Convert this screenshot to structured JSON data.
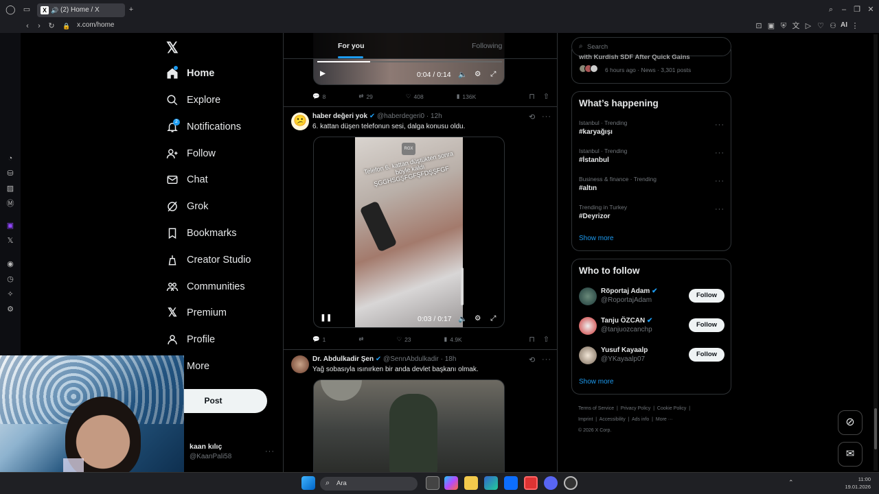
{
  "browser": {
    "tab_title": "(2) Home / X",
    "url": "x.com/home",
    "ai_label": "AI"
  },
  "nav": {
    "home": "Home",
    "explore": "Explore",
    "notifications": "Notifications",
    "notifications_badge": "2",
    "follow": "Follow",
    "chat": "Chat",
    "grok": "Grok",
    "bookmarks": "Bookmarks",
    "creator_studio": "Creator Studio",
    "communities": "Communities",
    "premium": "Premium",
    "profile": "Profile",
    "more": "More",
    "post": "Post",
    "user_name": "kaan kılıç",
    "user_handle": "@KaanPali58"
  },
  "feed": {
    "tab_for_you": "For you",
    "tab_following": "Following",
    "post0": {
      "time": "0:04 / 0:14",
      "replies": "8",
      "reposts": "29",
      "likes": "408",
      "views": "136K"
    },
    "post1": {
      "author": "haber değeri yok",
      "handle": "@haberdegeri0",
      "time": "12h",
      "text": "6. kattan düşen telefonun sesi, dalga konusu oldu.",
      "overlay_text": "Telefon 6. kattan düştükten sonra böyle kaldı ŞGGHSGŞFGFŞFDŞŞFGF",
      "video_time": "0:03 / 0:17",
      "replies": "1",
      "likes": "23",
      "views": "4.9K"
    },
    "post2": {
      "author": "Dr. Abdulkadir Şen",
      "handle": "@SennAbdulkadir",
      "time": "18h",
      "text": "Yağ sobasıyla ısınırken bir anda devlet başkanı olmak."
    }
  },
  "right": {
    "search_placeholder": "Search",
    "news_headline": "with Kurdish SDF After Quick Gains",
    "news_meta": "6 hours ago · News · 3,301 posts",
    "whats_happening": "What’s happening",
    "trends": [
      {
        "meta": "Istanbul · Trending",
        "tag": "#karyağışı"
      },
      {
        "meta": "Istanbul · Trending",
        "tag": "#İstanbul"
      },
      {
        "meta": "Business & finance · Trending",
        "tag": "#altın"
      },
      {
        "meta": "Trending in Turkey",
        "tag": "#Deyrizor"
      }
    ],
    "show_more": "Show more",
    "who_to_follow": "Who to follow",
    "suggestions": [
      {
        "name": "Röportaj Adam",
        "handle": "@RoportajAdam",
        "button": "Follow"
      },
      {
        "name": "Tanju ÖZCAN",
        "handle": "@tanjuozcanchp",
        "button": "Follow"
      },
      {
        "name": "Yusuf Kayaalp",
        "handle": "@YKayaalp07",
        "button": "Follow"
      }
    ],
    "footer": {
      "terms": "Terms of Service",
      "privacy": "Privacy Policy",
      "cookie": "Cookie Policy",
      "imprint": "Imprint",
      "accessibility": "Accessibility",
      "ads": "Ads info",
      "more": "More ···",
      "copyright": "© 2026 X Corp."
    }
  },
  "taskbar": {
    "search_placeholder": "Ara",
    "time": "11:00",
    "date": "19.01.2026"
  },
  "colors": {
    "accent": "#1d9bf0",
    "background": "#000000",
    "border": "#2f3336",
    "muted": "#71767b"
  }
}
